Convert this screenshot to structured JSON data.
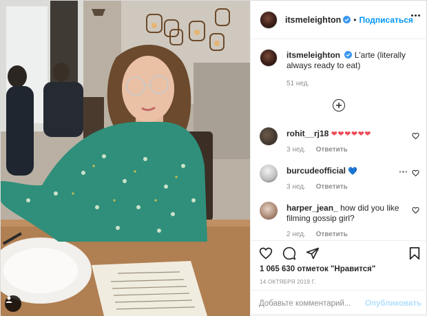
{
  "post": {
    "author": "itsmeleighton",
    "follow_label": "Подписаться",
    "dot": "•",
    "caption_text": "L'arte (literally always ready to eat)",
    "caption_time": "51 нед.",
    "likes": "1 065 630 отметок \"Нравится\"",
    "date": "14 октября 2019 г."
  },
  "comments": [
    {
      "username": "rohit__rj18",
      "text": "❤❤❤❤❤❤",
      "time": "3 нед.",
      "reply_label": "Ответить"
    },
    {
      "username": "burcudeofficial",
      "text": "💙",
      "time": "3 нед.",
      "reply_label": "Ответить"
    },
    {
      "username": "harper_jean_",
      "text": "how did you like filming gossip girl?",
      "time": "2 нед.",
      "reply_label": "Ответить"
    }
  ],
  "add_comment": {
    "placeholder": "Добавьте комментарий...",
    "publish_label": "Опубликовать"
  },
  "icons": {
    "verified": "verified-badge-icon",
    "more": "more-options-icon",
    "load_more": "plus-circle-icon",
    "like": "heart-icon",
    "comment": "comment-icon",
    "share": "share-icon",
    "save": "bookmark-icon",
    "tag": "user-tag-icon"
  },
  "colors": {
    "accent": "#0095f6",
    "heart": "#ed4956",
    "publish_disabled": "#b2dffc",
    "muted": "#8e8e8e"
  }
}
